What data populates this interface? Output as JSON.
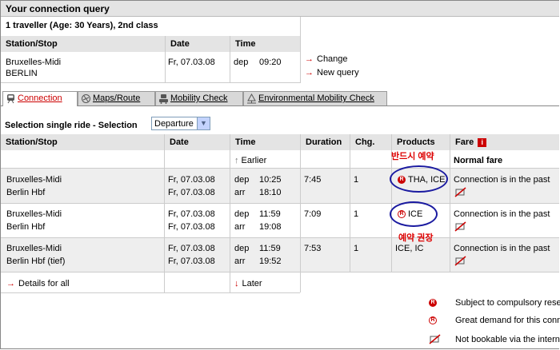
{
  "header": {
    "title": "Your connection query"
  },
  "query": {
    "traveller": "1 traveller (Age: 30 Years), 2nd class",
    "col_station": "Station/Stop",
    "col_date": "Date",
    "col_time": "Time",
    "from": "Bruxelles-Midi",
    "to": "BERLIN",
    "date": "Fr,  07.03.08",
    "dep_label": "dep",
    "dep_time": "09:20",
    "change_label": "Change",
    "new_query_label": "New query"
  },
  "tabs": [
    {
      "label": "Connection",
      "icon": "train-icon",
      "active": true
    },
    {
      "label": "Maps/Route",
      "icon": "map-icon",
      "active": false
    },
    {
      "label": "Mobility Check",
      "icon": "car-train-icon",
      "active": false
    },
    {
      "label": "Environmental Mobility Check",
      "icon": "environment-icon",
      "active": false
    }
  ],
  "selection": {
    "label": "Selection single ride  - Selection",
    "value": "Departure"
  },
  "table": {
    "headers": {
      "station": "Station/Stop",
      "date": "Date",
      "time": "Time",
      "duration": "Duration",
      "changes": "Chg.",
      "products": "Products",
      "fare": "Fare"
    },
    "earlier": "Earlier",
    "normal_fare": "Normal fare",
    "rows": [
      {
        "from": "Bruxelles-Midi",
        "to": "Berlin Hbf",
        "date_dep": "Fr, 07.03.08",
        "date_arr": "Fr, 07.03.08",
        "dep": "dep",
        "dep_time": "10:25",
        "arr": "arr",
        "arr_time": "18:10",
        "duration": "7:45",
        "changes": "1",
        "products": "THA, ICE",
        "fare": "Connection is in the past"
      },
      {
        "from": "Bruxelles-Midi",
        "to": "Berlin Hbf",
        "date_dep": "Fr, 07.03.08",
        "date_arr": "Fr, 07.03.08",
        "dep": "dep",
        "dep_time": "11:59",
        "arr": "arr",
        "arr_time": "19:08",
        "duration": "7:09",
        "changes": "1",
        "products": "ICE",
        "fare": "Connection is in the past"
      },
      {
        "from": "Bruxelles-Midi",
        "to": "Berlin Hbf (tief)",
        "date_dep": "Fr, 07.03.08",
        "date_arr": "Fr, 07.03.08",
        "dep": "dep",
        "dep_time": "11:59",
        "arr": "arr",
        "arr_time": "19:52",
        "duration": "7:53",
        "changes": "1",
        "products": "ICE, IC",
        "fare": "Connection is in the past"
      }
    ],
    "details_all": "Details for all",
    "later": "Later"
  },
  "annotations": {
    "must_reserve": "반드시 예약",
    "reserve_recommended": "예약 권장"
  },
  "legend": [
    {
      "icon": "reservation-required-icon",
      "text": "Subject to compulsory rese"
    },
    {
      "icon": "reservation-recommended-icon",
      "text": "Great demand for this conn"
    },
    {
      "icon": "not-bookable-icon",
      "text": "Not bookable via the interne"
    }
  ],
  "colors": {
    "accent": "#cc0000",
    "header_bg": "#e4e4e4",
    "row_alt": "#eeeeee",
    "annotation_ring": "#1a1aa0"
  }
}
